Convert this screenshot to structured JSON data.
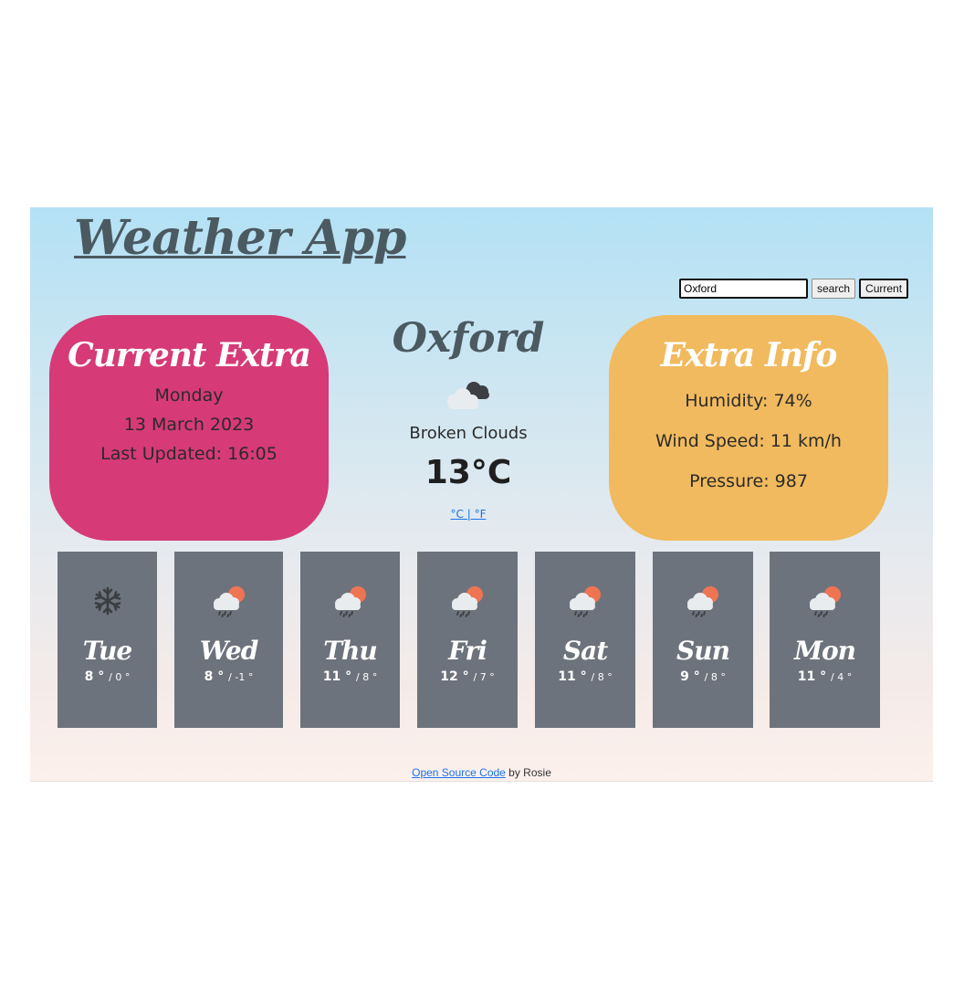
{
  "app": {
    "title": "Weather App"
  },
  "search": {
    "value": "Oxford",
    "search_label": "search",
    "current_label": "Current"
  },
  "current_extra": {
    "title": "Current Extra",
    "day": "Monday",
    "date": "13 March 2023",
    "updated": "Last Updated: 16:05"
  },
  "current": {
    "city": "Oxford",
    "icon": "broken-clouds-icon",
    "description": "Broken Clouds",
    "temperature": "13°C",
    "unit_toggle": "°C | °F"
  },
  "extra_info": {
    "title": "Extra Info",
    "humidity": "Humidity: 74%",
    "wind": "Wind Speed: 11 km/h",
    "pressure": "Pressure: 987"
  },
  "forecast": [
    {
      "day": "Tue",
      "max": "8 °",
      "min": "/ 0 °",
      "icon": "snowflake-icon"
    },
    {
      "day": "Wed",
      "max": "8 °",
      "min": "/ -1 °",
      "icon": "rain-sun-icon"
    },
    {
      "day": "Thu",
      "max": "11 °",
      "min": "/ 8 °",
      "icon": "rain-sun-icon"
    },
    {
      "day": "Fri",
      "max": "12 °",
      "min": "/ 7 °",
      "icon": "rain-sun-icon"
    },
    {
      "day": "Sat",
      "max": "11 °",
      "min": "/ 8 °",
      "icon": "rain-sun-icon"
    },
    {
      "day": "Sun",
      "max": "9 °",
      "min": "/ 8 °",
      "icon": "rain-sun-icon"
    },
    {
      "day": "Mon",
      "max": "11 °",
      "min": "/ 4 °",
      "icon": "rain-sun-icon"
    }
  ],
  "footer": {
    "link_text": "Open Source Code",
    "suffix": " by Rosie"
  },
  "colors": {
    "current_extra_card": "#d63a77",
    "extra_info_card": "#f1ba5e",
    "forecast_card": "#6d737c",
    "title_text": "#4b5a61"
  }
}
